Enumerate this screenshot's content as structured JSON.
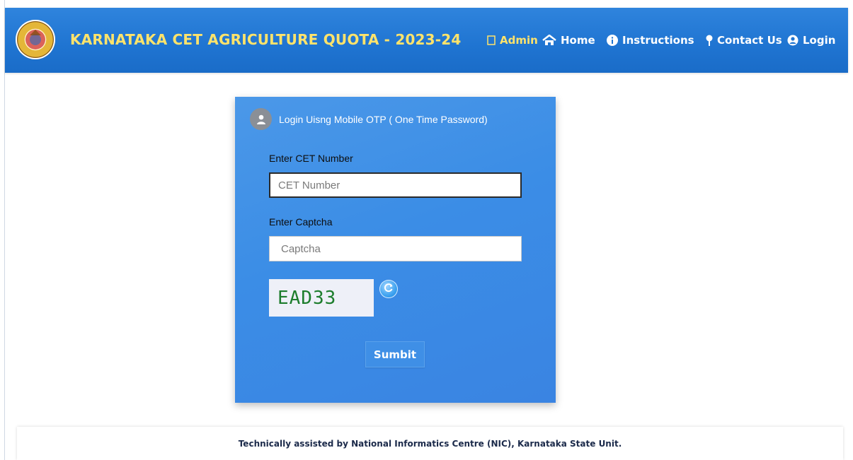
{
  "header": {
    "title": "KARNATAKA CET AGRICULTURE QUOTA - 2023-24",
    "emblem_icon": "karnataka-government-emblem",
    "nav": [
      {
        "label": "Admin",
        "icon": "admin-icon",
        "color": "#ffe36b"
      },
      {
        "label": "Home",
        "icon": "home-icon"
      },
      {
        "label": "Instructions",
        "icon": "info-circle-icon"
      },
      {
        "label": "Contact Us",
        "icon": "map-pin-icon"
      },
      {
        "label": "Login",
        "icon": "user-circle-icon"
      }
    ],
    "background_color": "#1f74d1",
    "title_color": "#ffe36b"
  },
  "login_card": {
    "title": "Login Uisng Mobile OTP ( One Time Password)",
    "cet_label": "Enter CET Number",
    "cet_placeholder": "CET Number",
    "captcha_label": "Enter Captcha",
    "captcha_placeholder": "Captcha",
    "captcha_image_text": "EAD33",
    "submit_label": "Sumbit",
    "card_color": "#3b8de6"
  },
  "footer": {
    "text": "Technically assisted by National Informatics Centre (NIC), Karnataka State Unit."
  }
}
